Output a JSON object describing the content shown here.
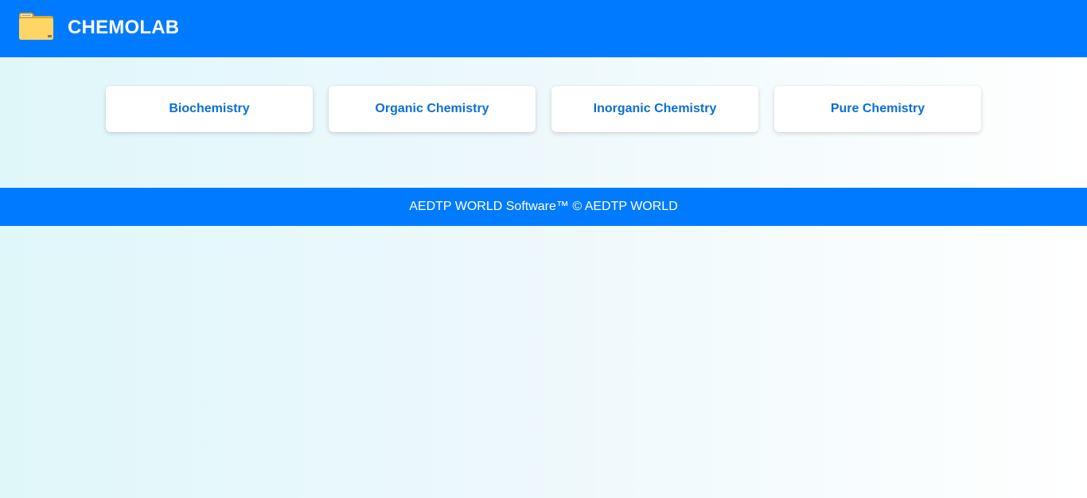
{
  "header": {
    "title": "CHEMOLAB",
    "icon": "folder-icon",
    "background_color": "#007bff"
  },
  "nav": {
    "items": [
      {
        "label": "Biochemistry"
      },
      {
        "label": "Organic Chemistry"
      },
      {
        "label": "Inorganic Chemistry"
      },
      {
        "label": "Pure Chemistry"
      }
    ],
    "label_color": "#0a6fd6"
  },
  "footer": {
    "text": "AEDTP WORLD Software™ © AEDTP WORLD",
    "background_color": "#007bff"
  }
}
